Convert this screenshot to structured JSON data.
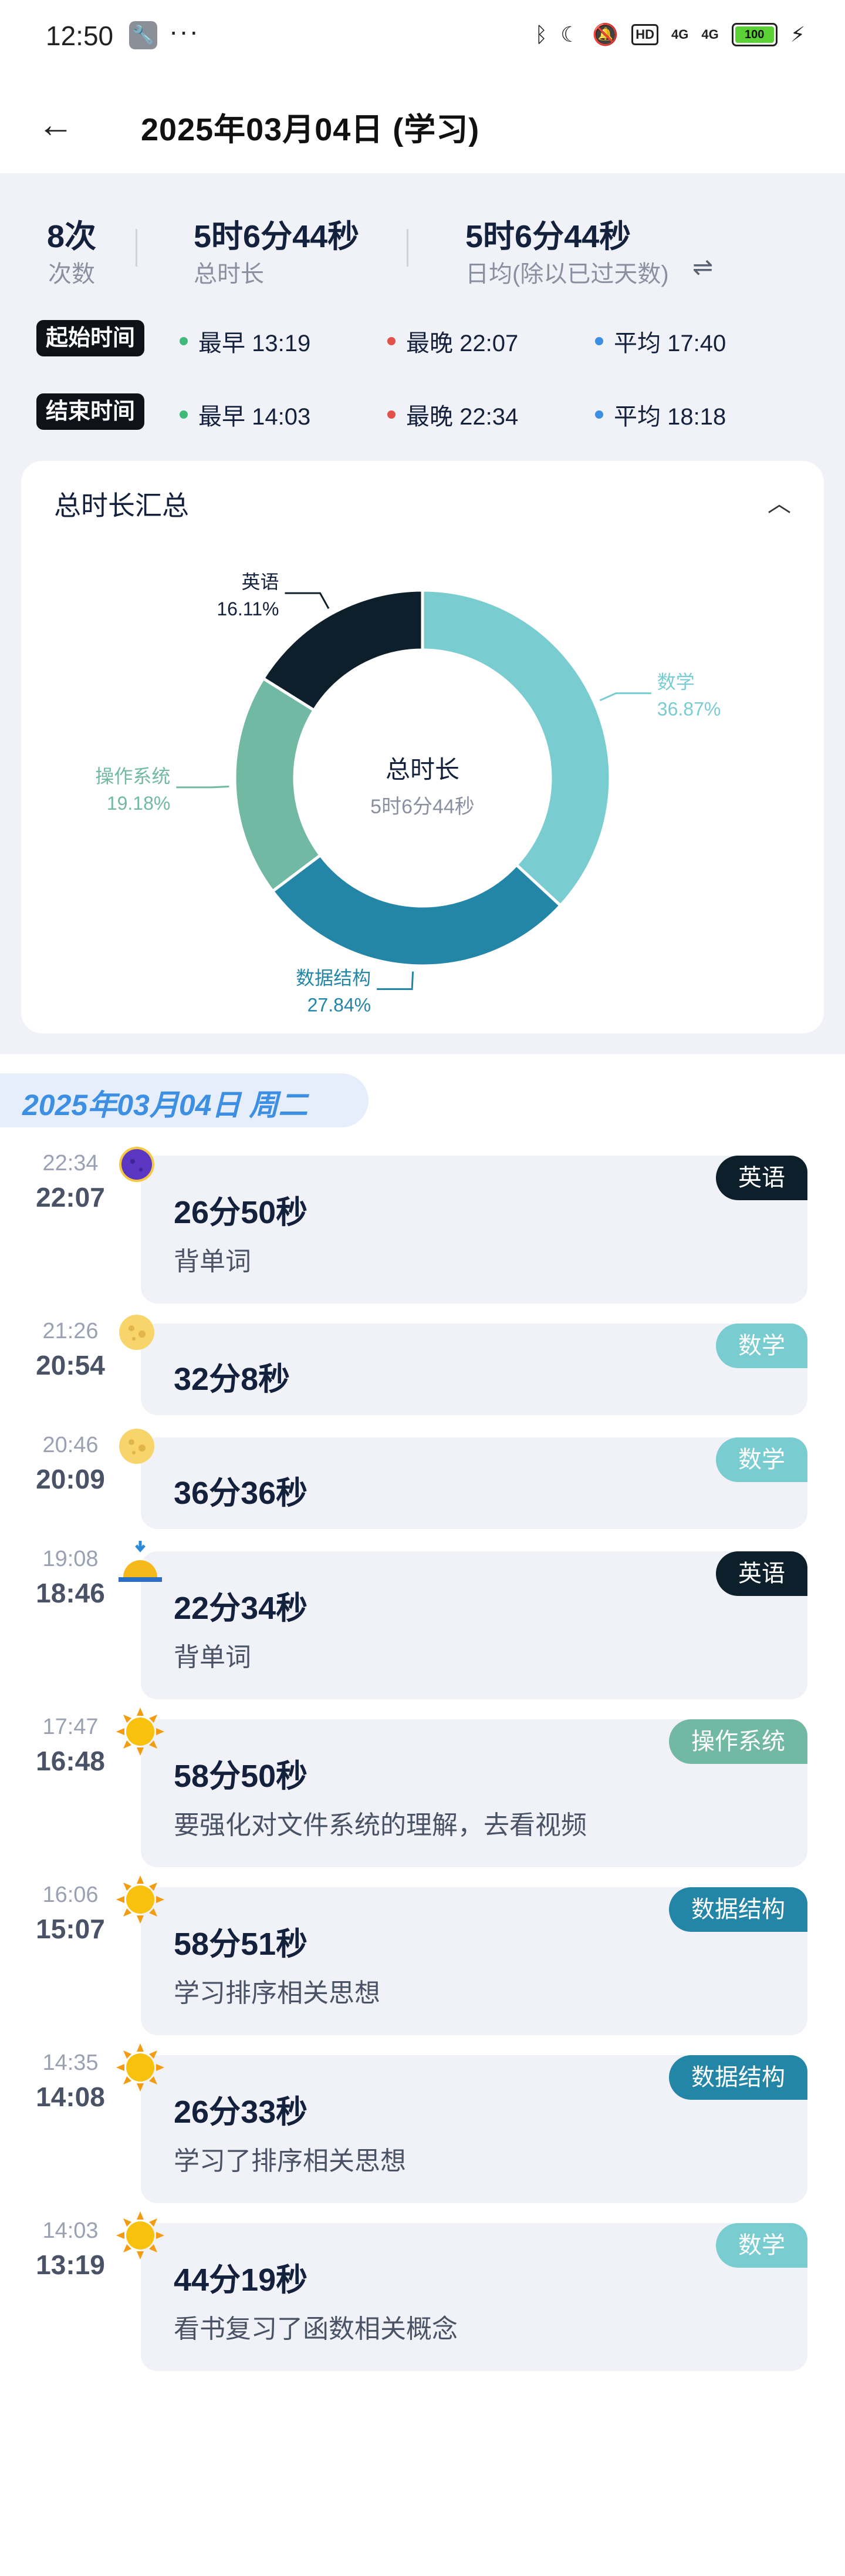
{
  "status_bar": {
    "time": "12:50",
    "tool_icon": "wrench-icon",
    "more": "···",
    "hd": "HD",
    "sig1": "4G",
    "sig2": "4G",
    "battery": "100"
  },
  "header": {
    "back_icon": "arrow-left-icon",
    "title": "2025年03月04日 (学习)"
  },
  "stats": {
    "count_value": "8次",
    "count_label": "次数",
    "total_value": "5时6分44秒",
    "total_label": "总时长",
    "avg_value": "5时6分44秒",
    "avg_label": "日均(除以已过天数)",
    "swap_icon": "⇌"
  },
  "start_times": {
    "label": "起始时间",
    "earliest": "最早 13:19",
    "latest": "最晚 22:07",
    "average": "平均 17:40"
  },
  "end_times": {
    "label": "结束时间",
    "earliest": "最早 14:03",
    "latest": "最晚 22:34",
    "average": "平均 18:18"
  },
  "colors": {
    "earliest": "#3fba7b",
    "latest": "#e2514a",
    "average": "#3d8fe3",
    "english": "#0e1f2c",
    "math": "#79cdd0",
    "os": "#72b9a4",
    "ds": "#2486a6"
  },
  "chart_card": {
    "title": "总时长汇总",
    "collapse_icon": "^",
    "center_title": "总时长",
    "center_value": "5时6分44秒"
  },
  "chart_data": {
    "type": "pie",
    "title": "总时长汇总",
    "slices": [
      {
        "name": "数学",
        "value": 36.87,
        "label": "36.87%",
        "color": "#79cdd0"
      },
      {
        "name": "数据结构",
        "value": 27.84,
        "label": "27.84%",
        "color": "#2486a6"
      },
      {
        "name": "操作系统",
        "value": 19.18,
        "label": "19.18%",
        "color": "#72b9a4"
      },
      {
        "name": "英语",
        "value": 16.11,
        "label": "16.11%",
        "color": "#0e1f2c"
      }
    ]
  },
  "timeline": {
    "date": "2025年03月04日 周二",
    "entries": [
      {
        "end": "22:34",
        "start": "22:07",
        "icon": "moon-icon",
        "duration": "26分50秒",
        "note": "背单词",
        "subject": "英语",
        "subject_color": "#0e1f2c"
      },
      {
        "end": "21:26",
        "start": "20:54",
        "icon": "full-moon-icon",
        "duration": "32分8秒",
        "note": "",
        "subject": "数学",
        "subject_color": "#79cdd0"
      },
      {
        "end": "20:46",
        "start": "20:09",
        "icon": "full-moon-icon",
        "duration": "36分36秒",
        "note": "",
        "subject": "数学",
        "subject_color": "#79cdd0"
      },
      {
        "end": "19:08",
        "start": "18:46",
        "icon": "sunset-icon",
        "duration": "22分34秒",
        "note": "背单词",
        "subject": "英语",
        "subject_color": "#0e1f2c"
      },
      {
        "end": "17:47",
        "start": "16:48",
        "icon": "sun-icon",
        "duration": "58分50秒",
        "note": "要强化对文件系统的理解，去看视频",
        "subject": "操作系统",
        "subject_color": "#72b9a4"
      },
      {
        "end": "16:06",
        "start": "15:07",
        "icon": "sun-icon",
        "duration": "58分51秒",
        "note": "学习排序相关思想",
        "subject": "数据结构",
        "subject_color": "#2486a6"
      },
      {
        "end": "14:35",
        "start": "14:08",
        "icon": "sun-icon",
        "duration": "26分33秒",
        "note": "学习了排序相关思想",
        "subject": "数据结构",
        "subject_color": "#2486a6"
      },
      {
        "end": "14:03",
        "start": "13:19",
        "icon": "sun-icon",
        "duration": "44分19秒",
        "note": "看书复习了函数相关概念",
        "subject": "数学",
        "subject_color": "#79cdd0"
      }
    ]
  }
}
